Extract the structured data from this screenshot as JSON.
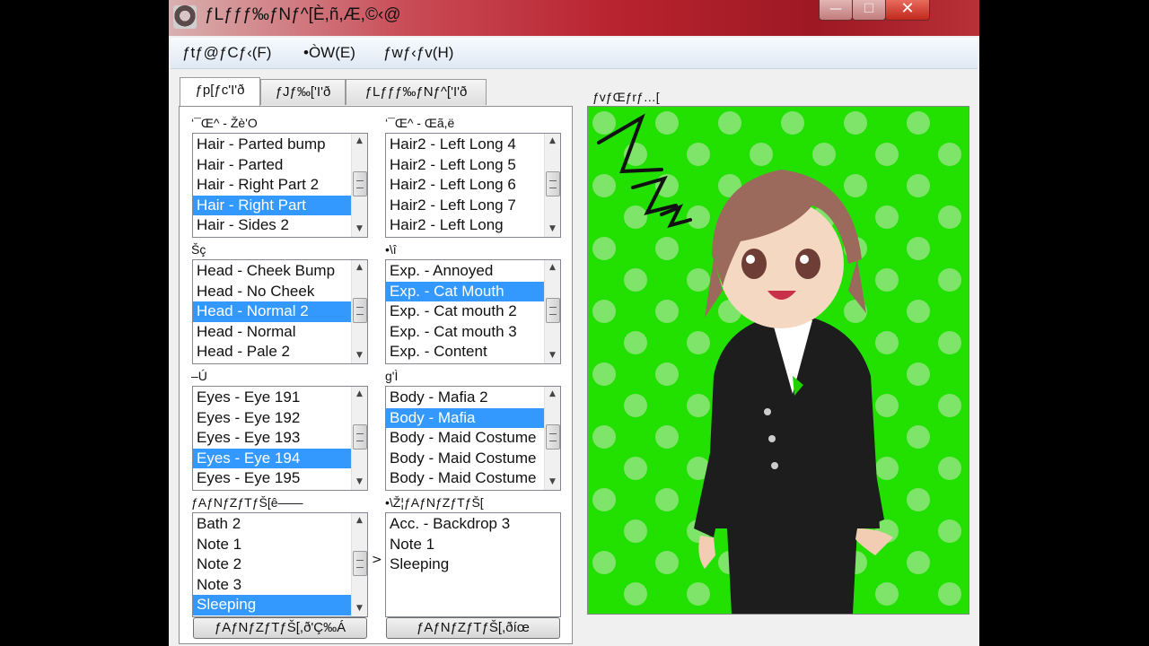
{
  "window": {
    "title": "ƒLƒƒƒ‰ƒNƒ^[È,ñ,Æ,©‹@",
    "controls": {
      "minimize": "—",
      "maximize": "☐",
      "close": "✕"
    }
  },
  "menu": [
    "ƒtƒ@ƒCƒ‹(F)",
    "•ÒW(E)",
    "ƒwƒ‹ƒv(H)"
  ],
  "tabs": [
    "ƒp[ƒc'I'ð",
    "ƒJƒ‰['I'ð",
    "ƒLƒƒƒ‰ƒNƒ^['I'ð"
  ],
  "groups": {
    "hair_front": {
      "label": "‘¯Œ^ - Žè'O",
      "items": [
        "Hair - Parted bump",
        "Hair - Parted",
        "Hair - Right Part 2",
        "Hair - Right Part",
        "Hair - Sides 2"
      ],
      "selected": "Hair - Right Part"
    },
    "hair_back": {
      "label": "‘¯Œ^ - Œã,ë",
      "items": [
        "Hair2 - Left Long 4",
        "Hair2 - Left Long 5",
        "Hair2 - Left Long 6",
        "Hair2 - Left Long 7",
        "Hair2 - Left Long"
      ],
      "selected": ""
    },
    "face": {
      "label": "Šç",
      "items": [
        "Head - Cheek Bump",
        "Head - No Cheek",
        "Head - Normal 2",
        "Head - Normal",
        "Head - Pale 2"
      ],
      "selected": "Head - Normal 2"
    },
    "expression": {
      "label": "•\\î",
      "items": [
        "Exp. - Annoyed",
        "Exp. - Cat Mouth",
        "Exp. - Cat mouth 2",
        "Exp. - Cat mouth 3",
        "Exp. - Content"
      ],
      "selected": "Exp. - Cat Mouth"
    },
    "eyes": {
      "label": "–Ú",
      "items": [
        "Eyes - Eye 191",
        "Eyes - Eye 192",
        "Eyes - Eye 193",
        "Eyes - Eye 194",
        "Eyes - Eye 195"
      ],
      "selected": "Eyes - Eye 194"
    },
    "body": {
      "label": "g'Ì",
      "items": [
        "Body - Mafia 2",
        "Body - Mafia",
        "Body - Maid Costume",
        "Body - Maid Costume",
        "Body - Maid Costume"
      ],
      "selected": "Body - Mafia"
    },
    "accessory_list": {
      "label": "ƒAƒNƒZƒTƒŠ[ê——",
      "items": [
        "Bath 2",
        "Note 1",
        "Note 2",
        "Note 3",
        "Sleeping"
      ],
      "selected": "Sleeping"
    },
    "accessory_equipped": {
      "label": "•\\Ž¦ƒAƒNƒZƒTƒŠ[",
      "items": [
        "Acc. - Backdrop 3",
        "Note 1",
        "Sleeping"
      ],
      "selected": ""
    }
  },
  "move_arrow": ">",
  "buttons": {
    "add": "ƒAƒNƒZƒTƒŠ[,ð'Ç‰Á",
    "remove": "ƒAƒNƒZƒTƒŠ[,ðíœ"
  },
  "preview": {
    "label": "ƒvƒŒƒrƒ…[",
    "background_color": "#22e000",
    "dot_color": "#7ee46a"
  },
  "colors": {
    "selection": "#3399ff",
    "titlebar": "#b8242f"
  },
  "icons": {
    "window_icon": "app-icon",
    "scroll_thumb": "grip-icon"
  }
}
